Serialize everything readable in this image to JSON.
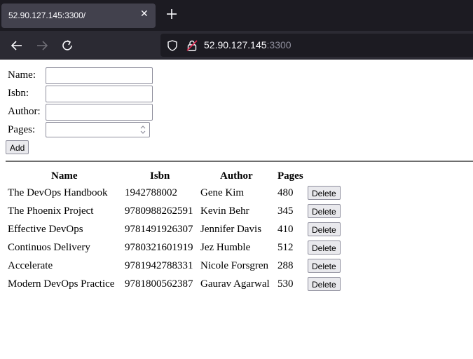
{
  "browser": {
    "tab_title": "52.90.127.145:3300/",
    "url_host": "52.90.127.145",
    "url_port": ":3300"
  },
  "form": {
    "name_label": "Name:",
    "isbn_label": "Isbn:",
    "author_label": "Author:",
    "pages_label": "Pages:",
    "name_value": "",
    "isbn_value": "",
    "author_value": "",
    "pages_value": "",
    "add_label": "Add"
  },
  "table": {
    "headers": [
      "Name",
      "Isbn",
      "Author",
      "Pages"
    ],
    "delete_label": "Delete",
    "rows": [
      {
        "name": "The DevOps Handbook",
        "isbn": "1942788002",
        "author": "Gene Kim",
        "pages": "480"
      },
      {
        "name": "The Phoenix Project",
        "isbn": "9780988262591",
        "author": "Kevin Behr",
        "pages": "345"
      },
      {
        "name": "Effective DevOps",
        "isbn": "9781491926307",
        "author": "Jennifer Davis",
        "pages": "410"
      },
      {
        "name": "Continuos Delivery",
        "isbn": "9780321601919",
        "author": "Jez Humble",
        "pages": "512"
      },
      {
        "name": "Accelerate",
        "isbn": "9781942788331",
        "author": "Nicole Forsgren",
        "pages": "288"
      },
      {
        "name": "Modern DevOps Practice",
        "isbn": "9781800562387",
        "author": "Gaurav Agarwal",
        "pages": "530"
      }
    ]
  }
}
